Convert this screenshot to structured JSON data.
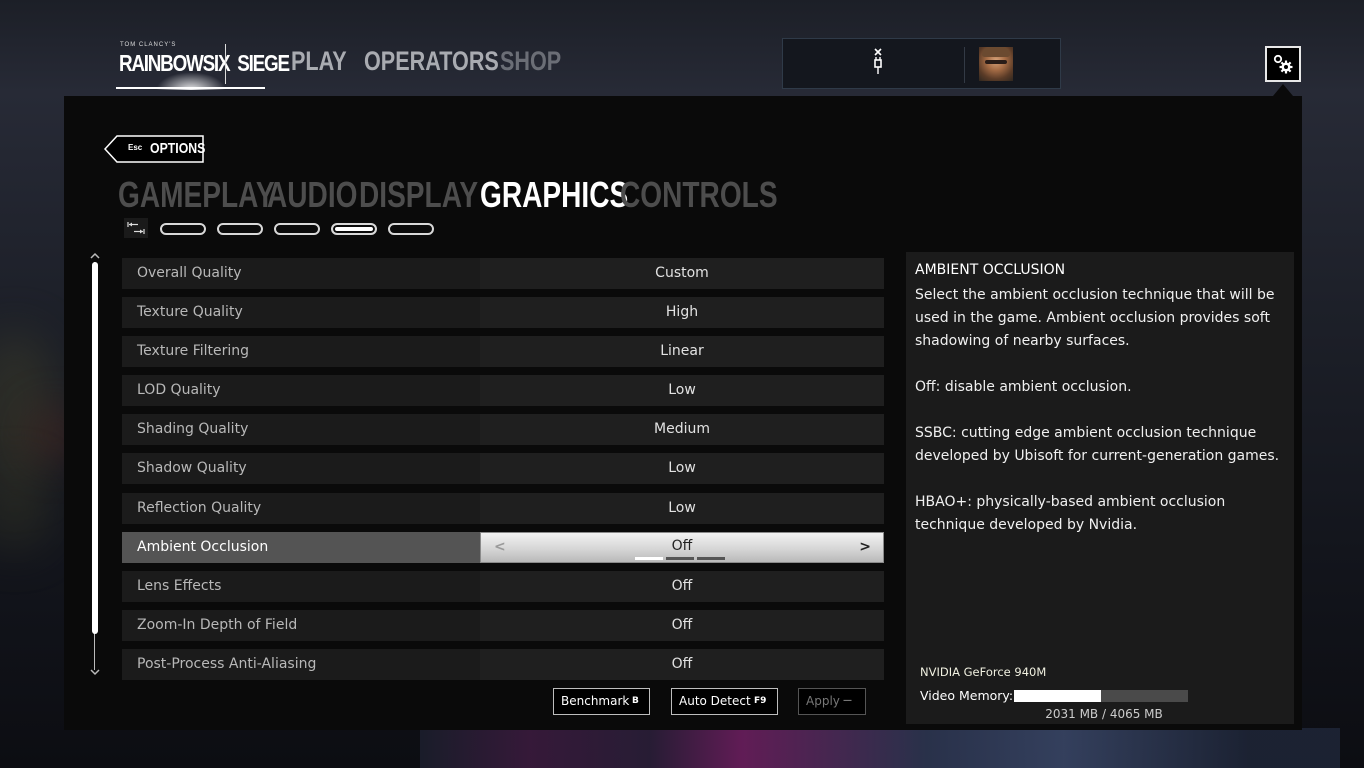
{
  "brand": {
    "small_text": "TOM CLANCY'S",
    "left": "RAINBOWSIX",
    "right": "SIEGE"
  },
  "top_nav": {
    "items": [
      {
        "label": "PLAY",
        "state": "normal"
      },
      {
        "label": "OPERATORS",
        "state": "normal"
      },
      {
        "label": "SHOP",
        "state": "dimmed"
      }
    ]
  },
  "status": {
    "connection_icon": "disconnected-plug-icon",
    "avatar": "operator-avatar"
  },
  "settings_button_icon": "gears-icon",
  "options": {
    "back_key": "Esc",
    "back_label": "OPTIONS",
    "tabs": [
      {
        "label": "GAMEPLAY",
        "active": false
      },
      {
        "label": "AUDIO",
        "active": false
      },
      {
        "label": "DISPLAY",
        "active": false
      },
      {
        "label": "GRAPHICS",
        "active": true
      },
      {
        "label": "CONTROLS",
        "active": false
      }
    ],
    "subtab_icon": "tab-switch-icon",
    "subtabs_count": 5,
    "subtab_active_index": 3
  },
  "settings": [
    {
      "label": "Overall Quality",
      "value": "Custom"
    },
    {
      "label": "Texture Quality",
      "value": "High"
    },
    {
      "label": "Texture Filtering",
      "value": "Linear"
    },
    {
      "label": "LOD Quality",
      "value": "Low"
    },
    {
      "label": "Shading Quality",
      "value": "Medium"
    },
    {
      "label": "Shadow Quality",
      "value": "Low"
    },
    {
      "label": "Reflection Quality",
      "value": "Low"
    },
    {
      "label": "Ambient Occlusion",
      "value": "Off",
      "selected": true,
      "option_count": 3,
      "option_index": 0
    },
    {
      "label": "Lens Effects",
      "value": "Off"
    },
    {
      "label": "Zoom-In Depth of Field",
      "value": "Off"
    },
    {
      "label": "Post-Process Anti-Aliasing",
      "value": "Off"
    }
  ],
  "selector_arrows": {
    "left": "<",
    "right": ">"
  },
  "scroll": {
    "up": "^",
    "down": "v",
    "visible_fraction": 0.91
  },
  "actions": {
    "benchmark": {
      "label": "Benchmark",
      "key": "B"
    },
    "auto_detect": {
      "label": "Auto Detect",
      "key": "F9"
    },
    "apply": {
      "label": "Apply",
      "key": "—",
      "enabled": false
    }
  },
  "info": {
    "title": "AMBIENT OCCLUSION",
    "body": "Select the ambient occlusion technique that will be used in the game. Ambient occlusion provides soft shadowing of nearby surfaces.\n\nOff: disable ambient occlusion.\n\nSSBC: cutting edge ambient occlusion technique developed by Ubisoft for current-generation games.\n\nHBAO+: physically-based ambient occlusion technique developed by Nvidia.",
    "gpu_name": "NVIDIA GeForce 940M",
    "video_memory_label": "Video Memory:",
    "video_memory_used_mb": 2031,
    "video_memory_total_mb": 4065,
    "video_memory_text": "2031 MB / 4065 MB"
  },
  "colors": {
    "panel_bg": "#0a0a0a",
    "row_bg": "#1b1b1b",
    "selected_row_bg": "#545454",
    "tab_inactive": "#4d4d4d",
    "tab_active": "#ffffff"
  }
}
